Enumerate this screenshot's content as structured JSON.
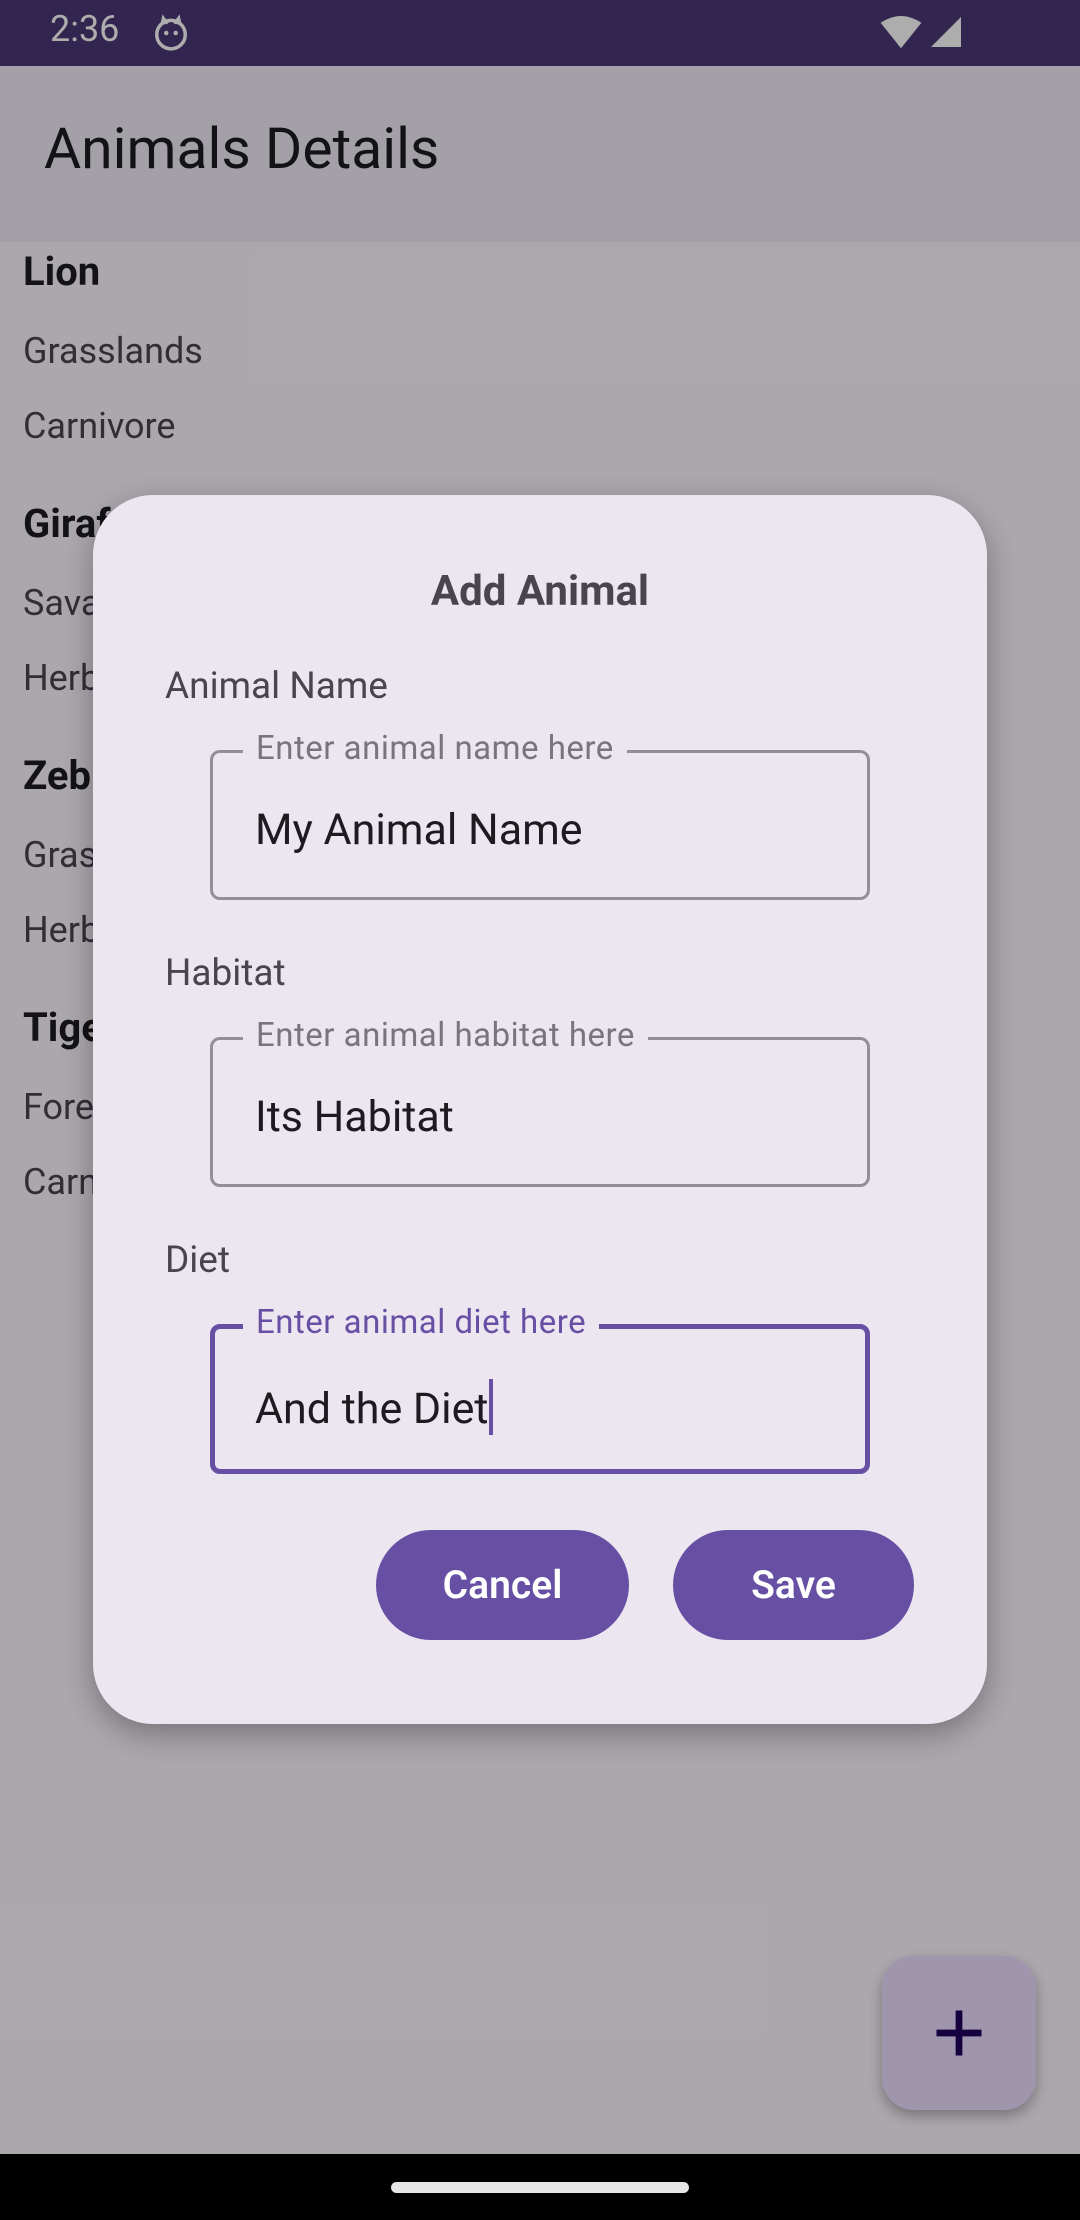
{
  "status_bar": {
    "time": "2:36"
  },
  "app_bar": {
    "title": "Animals Details"
  },
  "animals": [
    {
      "name": "Lion",
      "habitat": "Grasslands",
      "diet": "Carnivore"
    },
    {
      "name": "Giraffe",
      "habitat": "Savanna",
      "diet": "Herbivore"
    },
    {
      "name": "Zebra",
      "habitat": "Grasslands",
      "diet": "Herbivore"
    },
    {
      "name": "Tiger",
      "habitat": "Forests",
      "diet": "Carnivore"
    }
  ],
  "dialog": {
    "title": "Add Animal",
    "fields": [
      {
        "label": "Animal Name",
        "legend": "Enter animal name here",
        "value": "My Animal Name"
      },
      {
        "label": "Habitat",
        "legend": "Enter animal habitat here",
        "value": "Its Habitat"
      },
      {
        "label": "Diet",
        "legend": "Enter animal diet here",
        "value": "And the Diet"
      }
    ],
    "cancel_label": "Cancel",
    "save_label": "Save"
  },
  "fab": {
    "icon": "plus-icon"
  },
  "colors": {
    "primary": "#6750a4",
    "dialog_bg": "#ece6f0",
    "status_bar": "#4a3877"
  }
}
